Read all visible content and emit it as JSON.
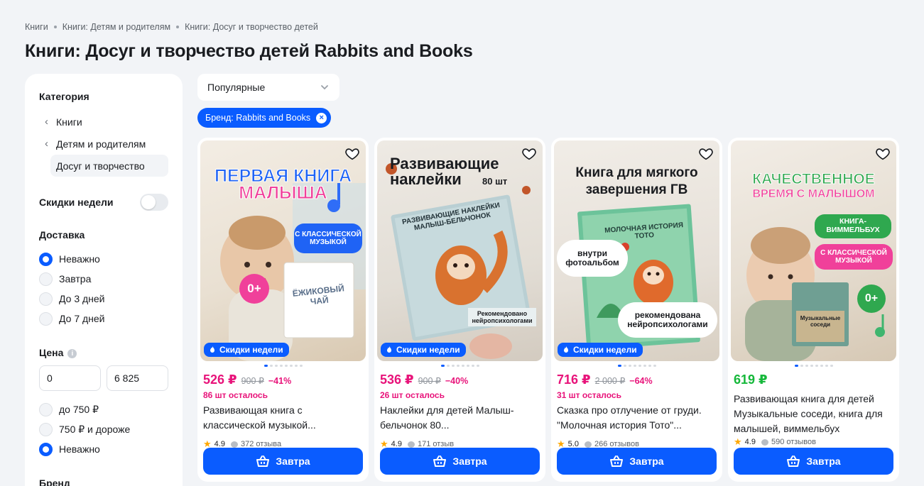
{
  "breadcrumb": [
    "Книги",
    "Книги: Детям и родителям",
    "Книги: Досуг и творчество детей"
  ],
  "page_title": "Книги: Досуг и творчество детей Rabbits and Books",
  "sidebar": {
    "category_heading": "Категория",
    "categories": [
      {
        "label": "Книги"
      },
      {
        "label": "Детям и родителям"
      },
      {
        "label": "Досуг и творчество"
      }
    ],
    "discounts_label": "Скидки недели",
    "delivery_heading": "Доставка",
    "delivery_options": [
      "Неважно",
      "Завтра",
      "До 3 дней",
      "До 7 дней"
    ],
    "price_heading": "Цена",
    "price_min": "0",
    "price_max": "6 825",
    "price_options": [
      "до 750 ₽",
      "750 ₽ и дороже",
      "Неважно"
    ],
    "brand_heading": "Бренд"
  },
  "sort": {
    "value": "Популярные"
  },
  "chip": {
    "label": "Бренд: Rabbits and Books",
    "clear_glyph": "×"
  },
  "products": [
    {
      "price": "526 ₽",
      "old_price": "900 ₽",
      "discount": "−41%",
      "stock": "86 шт осталось",
      "title": "Развивающая книга с классической музыкой...",
      "rating": "4.9",
      "reviews": "372 отзыва",
      "promo": "Скидки недели",
      "button": "Завтра",
      "cover": {
        "line1": "ПЕРВАЯ КНИГА",
        "line2": "МАЛЫША",
        "pill": "С КЛАССИЧЕСКОЙ МУЗЫКОЙ",
        "age": "0+",
        "book": "ЁЖИКОВЫЙ ЧАЙ"
      }
    },
    {
      "price": "536 ₽",
      "old_price": "900 ₽",
      "discount": "−40%",
      "stock": "26 шт осталось",
      "title": "Наклейки для детей Малыш-бельчонок 80...",
      "rating": "4.9",
      "reviews": "171 отзыв",
      "promo": "Скидки недели",
      "button": "Завтра",
      "cover": {
        "line1": "Развивающие",
        "line2": "наклейки",
        "count": "80 шт",
        "book": "РАЗВИВАЮЩИЕ НАКЛЕЙКИ МАЛЫШ-БЕЛЬЧОНОК",
        "note": "Рекомендовано нейропсихологами"
      }
    },
    {
      "price": "716 ₽",
      "old_price": "2 000 ₽",
      "discount": "−64%",
      "stock": "31 шт осталось",
      "title": "Сказка про отлучение от груди. \"Молочная история Тото\"...",
      "rating": "5.0",
      "reviews": "266 отзывов",
      "promo": "Скидки недели",
      "button": "Завтра",
      "cover": {
        "line1": "Книга для мягкого",
        "line2": "завершения ГВ",
        "book": "МОЛОЧНАЯ ИСТОРИЯ ТОТО",
        "bubble1": "внутри фотоальбом",
        "bubble2": "рекомендована нейропсихологами"
      }
    },
    {
      "price": "619 ₽",
      "old_price": "",
      "discount": "",
      "stock": "",
      "title": "Развивающая книга для детей Музыкальные соседи, книга для малышей, виммельбух",
      "rating": "4.9",
      "reviews": "590 отзывов",
      "promo": "",
      "button": "Завтра",
      "cover": {
        "line1": "КАЧЕСТВЕННОЕ",
        "line2": "ВРЕМЯ С МАЛЫШОМ",
        "pill1": "КНИГА-ВИММЕЛЬБУХ",
        "pill2": "С КЛАССИЧЕСКОЙ МУЗЫКОЙ",
        "age": "0+",
        "book": "Музыкальные соседи"
      }
    }
  ],
  "colors": {
    "accent": "#0a5cff",
    "price_sale": "#e8137a",
    "price_regular": "#15b83a",
    "rating_star": "#ffa800"
  }
}
